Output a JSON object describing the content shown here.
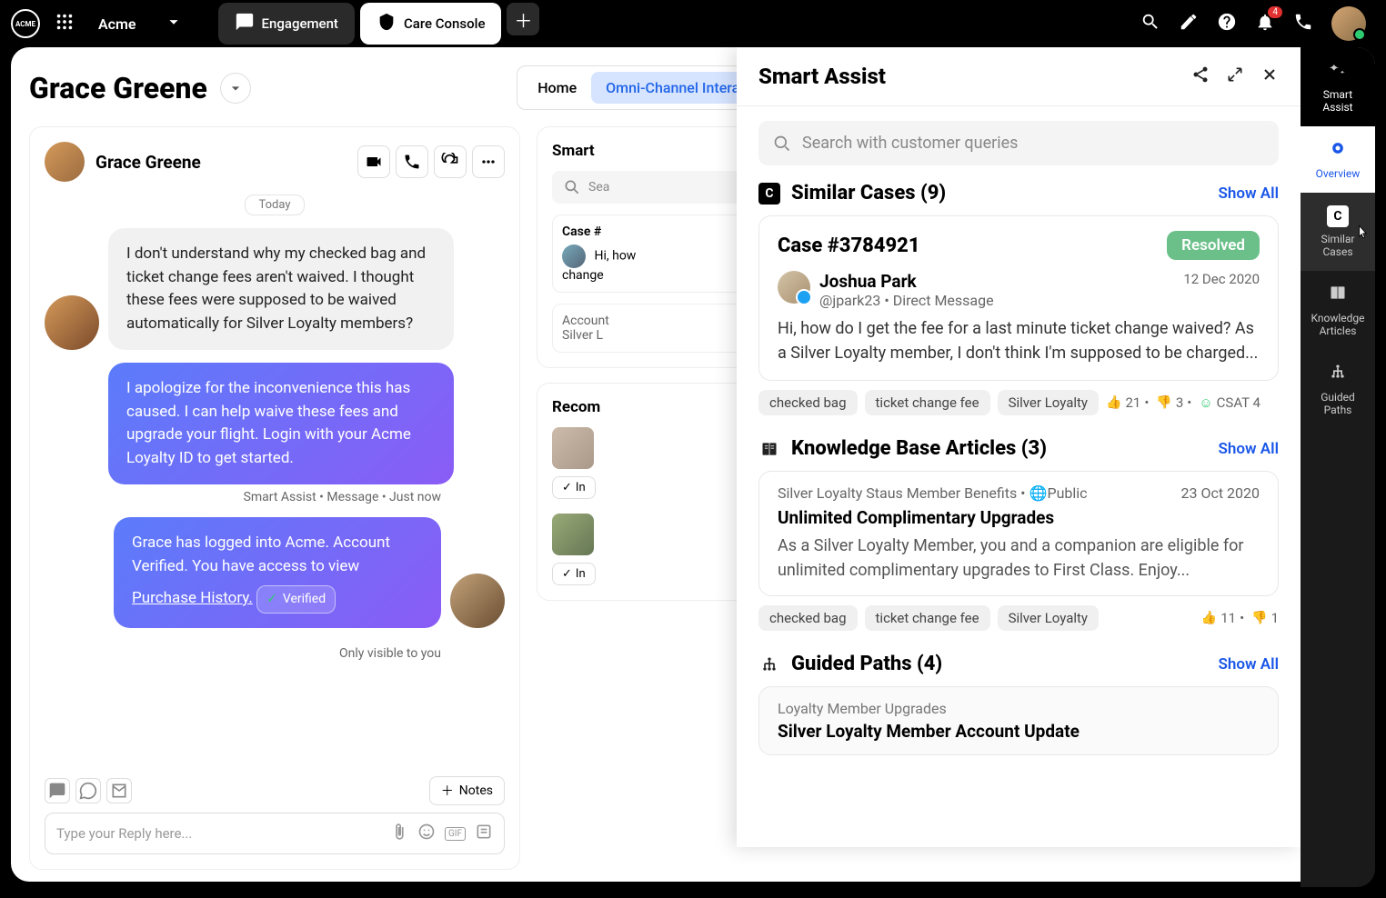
{
  "topbar": {
    "logo_text": "ACME",
    "brand": "Acme",
    "tabs": [
      {
        "label": "Engagement"
      },
      {
        "label": "Care Console"
      }
    ],
    "notification_count": "4"
  },
  "page": {
    "title": "Grace Greene",
    "breadcrumb": {
      "home": "Home",
      "active": "Omni-Channel Interaction"
    }
  },
  "chat": {
    "name": "Grace Greene",
    "date": "Today",
    "msg1": "I don't understand why my checked bag and ticket change fees aren't waived.  I thought these fees were supposed to be waived automatically for Silver Loyalty members?",
    "msg2": "I apologize for the inconvenience this has caused. I can help waive these fees and upgrade your flight. Login with your Acme Loyalty ID to get started.",
    "msg2_meta": "Smart Assist • Message • Just now",
    "msg3_a": "Grace has logged into Acme. Account Verified. You have access to view ",
    "msg3_link": "Purchase History.",
    "verified": "Verified",
    "msg3_meta": "Only visible to you",
    "notes_btn": "Notes",
    "reply_placeholder": "Type your Reply here..."
  },
  "mid": {
    "smart_title": "Smart",
    "search_ph": "Sea",
    "case_hdr": "Case #",
    "case_text": "Hi, how\nchange",
    "acct": "Account\nSilver L",
    "recom": "Recom",
    "insert": "In"
  },
  "assist": {
    "title": "Smart Assist",
    "search_placeholder": "Search with customer queries",
    "similar_cases": {
      "title": "Similar Cases (9)",
      "show_all": "Show All",
      "case_id": "Case #3784921",
      "status": "Resolved",
      "user_name": "Joshua Park",
      "user_handle": "@jpark23 • Direct Message",
      "date": "12 Dec 2020",
      "text": "Hi, how do I get the fee for a last minute ticket change waived? As a Silver Loyalty member, I don't think I'm supposed to be charged...",
      "tags": [
        "checked bag",
        "ticket change fee",
        "Silver Loyalty"
      ],
      "upvotes": "21",
      "downvotes": "3",
      "csat": "CSAT 4"
    },
    "kb": {
      "title": "Knowledge Base Articles (3)",
      "show_all": "Show All",
      "meta_left": "Silver Loyalty Staus Member Benefits • ",
      "meta_public": "Public",
      "date": "23 Oct 2020",
      "article_title": "Unlimited Complimentary Upgrades",
      "text": "As a Silver Loyalty Member, you and a companion are eligible for unlimited complimentary upgrades to First Class. Enjoy...",
      "tags": [
        "checked bag",
        "ticket change fee",
        "Silver Loyalty"
      ],
      "upvotes": "11",
      "downvotes": "1"
    },
    "guided": {
      "title": "Guided Paths (4)",
      "show_all": "Show All",
      "meta": "Loyalty Member Upgrades",
      "path_title": "Silver Loyalty Member Account Update"
    }
  },
  "rail": {
    "smart_assist": "Smart\nAssist",
    "overview": "Overview",
    "similar": "Similar\nCases",
    "knowledge": "Knowledge\nArticles",
    "guided": "Guided\nPaths"
  }
}
